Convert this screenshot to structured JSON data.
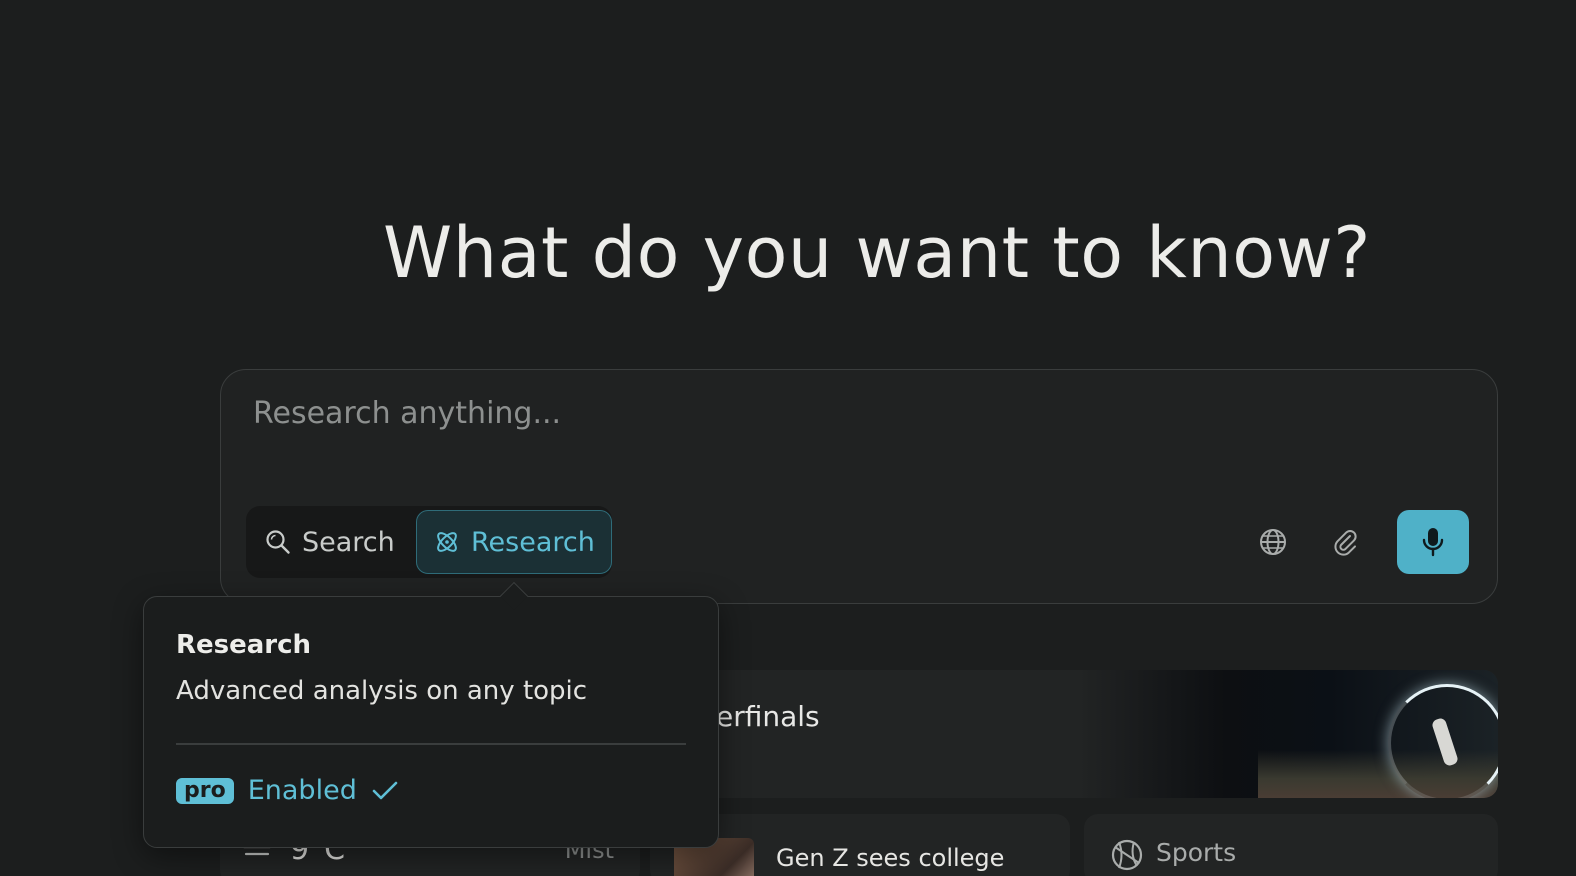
{
  "headline": "What do you want to know?",
  "query": {
    "placeholder": "Research anything...",
    "value": ""
  },
  "modes": {
    "search_label": "Search",
    "research_label": "Research",
    "active": "Research"
  },
  "tools": {
    "globe_icon": "globe-icon",
    "attach_icon": "paperclip-icon",
    "mic_icon": "microphone-icon"
  },
  "tooltip": {
    "title": "Research",
    "description": "Advanced analysis on any topic",
    "badge": "pro",
    "status": "Enabled",
    "status_icon": "checkmark-icon"
  },
  "cards": {
    "feature_title": "erfinals",
    "weather_temp": "9°C",
    "weather_condition": "Mist",
    "news_title": "Gen Z sees college",
    "sports_label": "Sports"
  },
  "colors": {
    "background": "#1c1e1e",
    "accent": "#4fb1c8",
    "accent_text": "#5fbfd6"
  }
}
